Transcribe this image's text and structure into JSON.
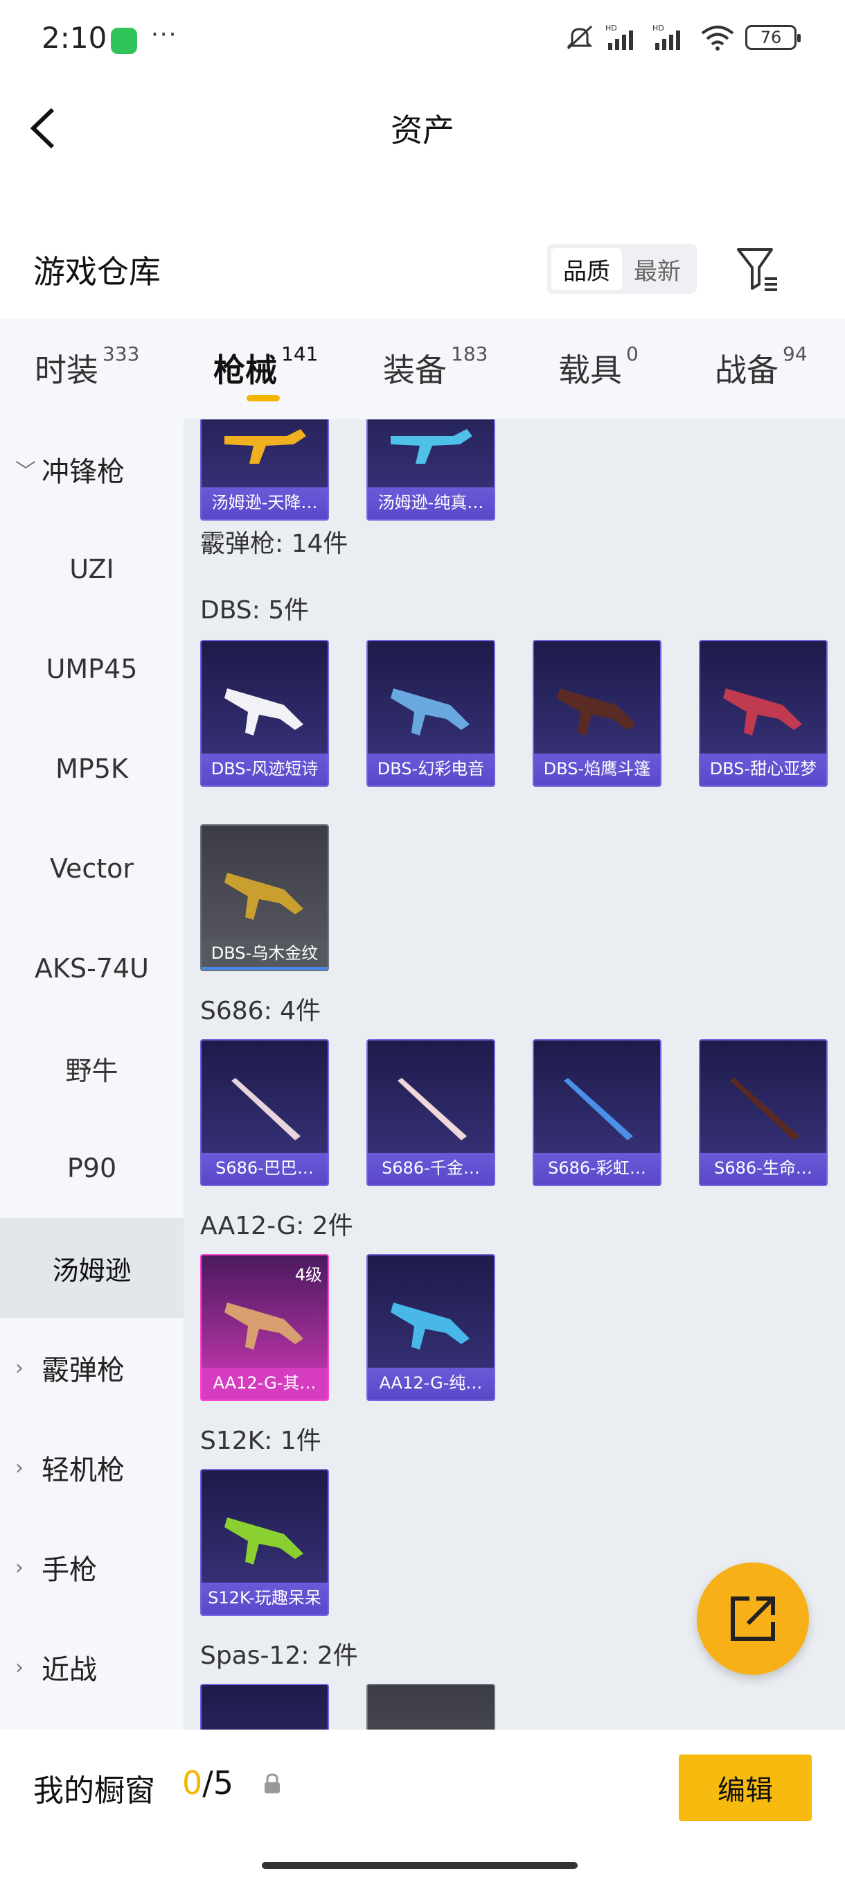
{
  "status": {
    "time": "2:10",
    "battery": "76"
  },
  "header": {
    "title": "资产",
    "section_title": "游戏仓库",
    "sort": [
      "品质",
      "最新"
    ]
  },
  "tabs": [
    {
      "label": "时装",
      "count": "333"
    },
    {
      "label": "枪械",
      "count": "141"
    },
    {
      "label": "装备",
      "count": "183"
    },
    {
      "label": "载具",
      "count": "0"
    },
    {
      "label": "战备",
      "count": "94"
    }
  ],
  "sidebar": {
    "items": [
      "冲锋枪",
      "UZI",
      "UMP45",
      "MP5K",
      "Vector",
      "AKS-74U",
      "野牛",
      "P90",
      "汤姆逊",
      "霰弹枪",
      "轻机枪",
      "手枪",
      "近战"
    ]
  },
  "content": {
    "top_cards": [
      "汤姆逊-天降…",
      "汤姆逊-纯真…"
    ],
    "shotgun_total": "霰弹枪: 14件",
    "groups": [
      {
        "label": "DBS: 5件",
        "items": [
          "DBS-风迹短诗",
          "DBS-幻彩电音",
          "DBS-焰鹰斗篷",
          "DBS-甜心亚梦",
          "DBS-乌木金纹"
        ]
      },
      {
        "label": "S686: 4件",
        "items": [
          "S686-巴巴…",
          "S686-千金…",
          "S686-彩虹…",
          "S686-生命…"
        ]
      },
      {
        "label": "AA12-G: 2件",
        "items": [
          "AA12-G-其…",
          "AA12-G-纯…"
        ],
        "level": "4级"
      },
      {
        "label": "S12K: 1件",
        "items": [
          "S12K-玩趣呆呆"
        ]
      },
      {
        "label": "Spas-12: 2件",
        "items": []
      }
    ]
  },
  "bottom": {
    "showcase_label": "我的橱窗",
    "current": "0",
    "total": "/5",
    "edit_label": "编辑"
  },
  "colors": {
    "accent": "#f7bb10",
    "card_purple": "#3b3680",
    "card_pink": "#d13ab7",
    "content_bg": "#eaedf1"
  }
}
